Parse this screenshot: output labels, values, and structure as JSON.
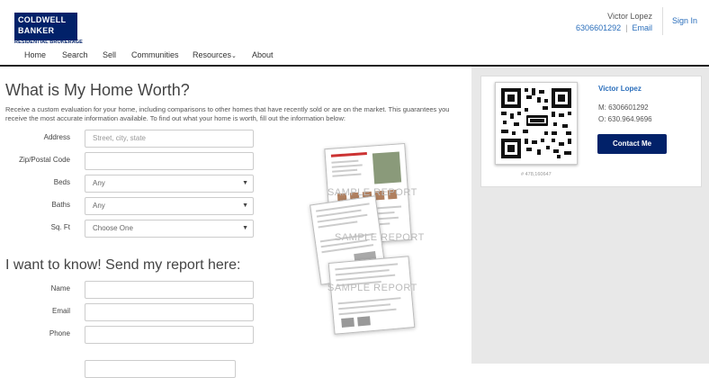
{
  "header": {
    "logo_line1": "COLDWELL",
    "logo_line2": "BANKER",
    "logo_sub": "RESIDENTIAL BROKERAGE",
    "agent_name": "Victor Lopez",
    "agent_phone": "6306601292",
    "separator": "|",
    "email_label": "Email",
    "sign_in": "Sign In"
  },
  "nav": {
    "items": [
      "Home",
      "Search",
      "Sell",
      "Communities",
      "Resources",
      "About"
    ]
  },
  "card": {
    "name": "Victor Lopez",
    "mobile": "M: 6306601292",
    "office": "O: 630.964.9696",
    "contact_button": "Contact Me",
    "id": "# 478,160647"
  },
  "form": {
    "title": "What is My Home Worth?",
    "intro": "Receive a custom evaluation for your home, including comparisons to other homes that have recently sold or are on the market. This guarantees you receive the most accurate information available. To find out what your home is worth, fill out the information below:",
    "address_label": "Address",
    "address_placeholder": "Street, city, state",
    "zip_label": "Zip/Postal Code",
    "beds_label": "Beds",
    "beds_value": "Any",
    "baths_label": "Baths",
    "baths_value": "Any",
    "sqft_label": "Sq. Ft",
    "sqft_value": "Choose One",
    "send_title": "I want to know! Send my report here:",
    "name_label": "Name",
    "email_label": "Email",
    "phone_label": "Phone"
  },
  "sample": {
    "watermark": "SAMPLE REPORT"
  }
}
